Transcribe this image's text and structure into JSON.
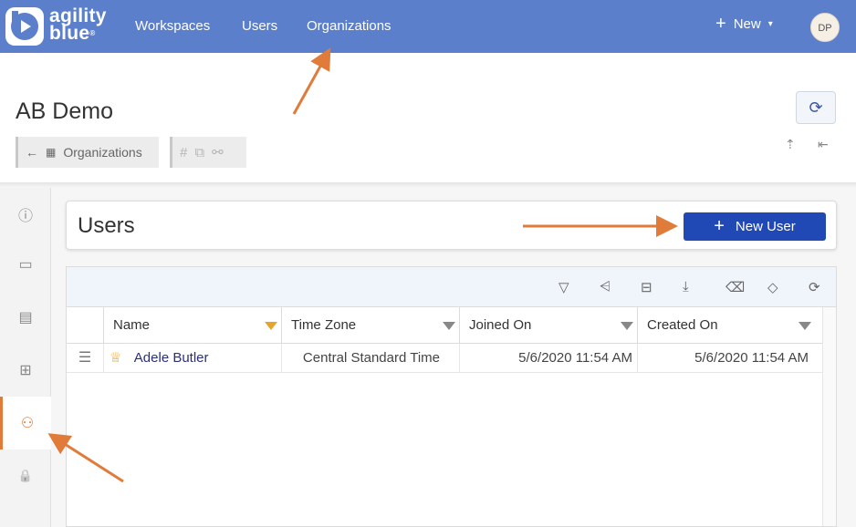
{
  "topnav": {
    "logo_line1": "agility",
    "logo_line2": "blue",
    "logo_reg": "®",
    "links": [
      "Workspaces",
      "Users",
      "Organizations"
    ],
    "new_label": "New",
    "new_plus": "+",
    "new_caret": "▾",
    "avatar_initials": "DP"
  },
  "page": {
    "title": "AB Demo",
    "refresh_icon": "⟳",
    "breadcrumb_back": "←",
    "breadcrumb_label": "Organizations",
    "hash": "#",
    "copy_icon": "⧉",
    "link_icon": "⚯",
    "export_icon": "⇡",
    "collapse_icon": "⇤"
  },
  "rail": {
    "icons": [
      "info-icon",
      "id-card-icon",
      "document-icon",
      "grid-icon",
      "users-icon",
      "lock-icon"
    ],
    "glyphs": [
      "ⓘ",
      "▭",
      "▤",
      "⊞",
      "⚇",
      "🔒"
    ]
  },
  "users_panel": {
    "title": "Users",
    "new_user_label": "New User",
    "new_user_plus": "+"
  },
  "toolbar_icons": [
    "filter-icon",
    "filter-list-icon",
    "columns-icon",
    "download-icon",
    "clear-icon",
    "eraser-icon",
    "refresh-icon"
  ],
  "toolbar_glyphs": [
    "▽",
    "⩤",
    "⊟",
    "⤓",
    "⌫",
    "◇",
    "⟳"
  ],
  "table": {
    "columns": [
      "Name",
      "Time Zone",
      "Joined On",
      "Created On"
    ],
    "rows": [
      {
        "menu": "☰",
        "crown": "♕",
        "name": "Adele Butler",
        "time_zone": "Central Standard Time",
        "joined_on": "5/6/2020 11:54 AM",
        "created_on": "5/6/2020 11:54 AM"
      }
    ]
  },
  "colors": {
    "nav_bg": "#5b7fcb",
    "accent_orange": "#e07b39",
    "primary_button": "#2149b6",
    "name_link": "#2a2f7a"
  }
}
